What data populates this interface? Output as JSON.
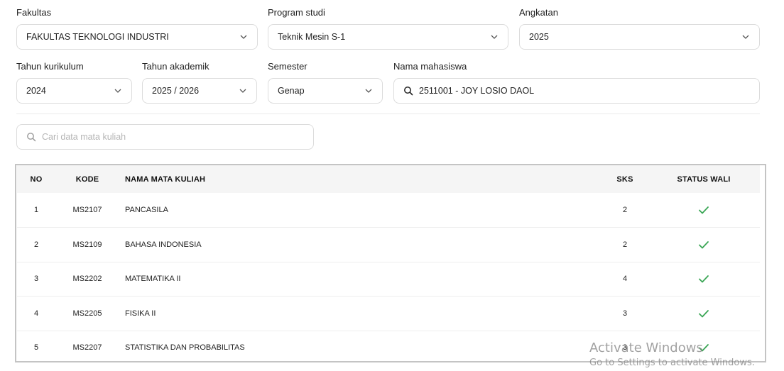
{
  "filters": {
    "fakultas": {
      "label": "Fakultas",
      "value": "FAKULTAS TEKNOLOGI INDUSTRI"
    },
    "program_studi": {
      "label": "Program studi",
      "value": "Teknik Mesin S-1"
    },
    "angkatan": {
      "label": "Angkatan",
      "value": "2025"
    },
    "tahun_kurikulum": {
      "label": "Tahun kurikulum",
      "value": "2024"
    },
    "tahun_akademik": {
      "label": "Tahun akademik",
      "value": "2025 / 2026"
    },
    "semester": {
      "label": "Semester",
      "value": "Genap"
    },
    "nama_mahasiswa": {
      "label": "Nama mahasiswa",
      "value": "2511001 - JOY LOSIO DAOL"
    }
  },
  "course_search": {
    "placeholder": "Cari data mata kuliah"
  },
  "table": {
    "headers": {
      "no": "NO",
      "kode": "KODE",
      "nama": "NAMA MATA KULIAH",
      "sks": "SKS",
      "status": "STATUS WALI"
    },
    "rows": [
      {
        "no": "1",
        "kode": "MS2107",
        "nama": "PANCASILA",
        "sks": "2",
        "status": "approved"
      },
      {
        "no": "2",
        "kode": "MS2109",
        "nama": "BAHASA INDONESIA",
        "sks": "2",
        "status": "approved"
      },
      {
        "no": "3",
        "kode": "MS2202",
        "nama": "MATEMATIKA II",
        "sks": "4",
        "status": "approved"
      },
      {
        "no": "4",
        "kode": "MS2205",
        "nama": "FISIKA II",
        "sks": "3",
        "status": "approved"
      },
      {
        "no": "5",
        "kode": "MS2207",
        "nama": "STATISTIKA DAN PROBABILITAS",
        "sks": "3",
        "status": "approved"
      }
    ]
  },
  "colors": {
    "check": "#3aa655",
    "border": "#dcdcdc",
    "header_bg": "#f5f5f5"
  },
  "watermark": {
    "line1": "Activate Windows",
    "line2": "Go to Settings to activate Windows."
  }
}
